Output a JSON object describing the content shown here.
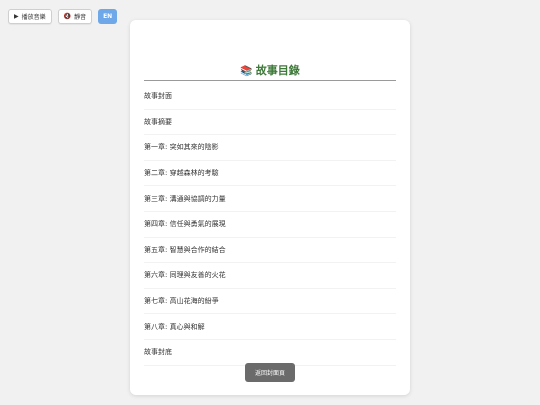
{
  "toolbar": {
    "play_label": "播放音樂",
    "play_icon": "play-icon",
    "mute_label": "靜音",
    "mute_icon": "mute-icon",
    "lang_label": "EN",
    "lang_color": "#6fa8e8"
  },
  "card": {
    "title": "故事目錄",
    "title_icon": "books-icon",
    "title_color": "#3d7a38",
    "items": [
      {
        "label": "故事封面"
      },
      {
        "label": "故事摘要"
      },
      {
        "label": "第一章: 突如其來的陰影"
      },
      {
        "label": "第二章: 穿越森林的考驗"
      },
      {
        "label": "第三章: 溝通與協調的力量"
      },
      {
        "label": "第四章: 信任與勇氣的展現"
      },
      {
        "label": "第五章: 智慧與合作的結合"
      },
      {
        "label": "第六章: 同理與友善的火花"
      },
      {
        "label": "第七章: 高山花海的紛爭"
      },
      {
        "label": "第八章: 真心與和解"
      },
      {
        "label": "故事封底"
      }
    ],
    "back_label": "返回封面頁"
  }
}
